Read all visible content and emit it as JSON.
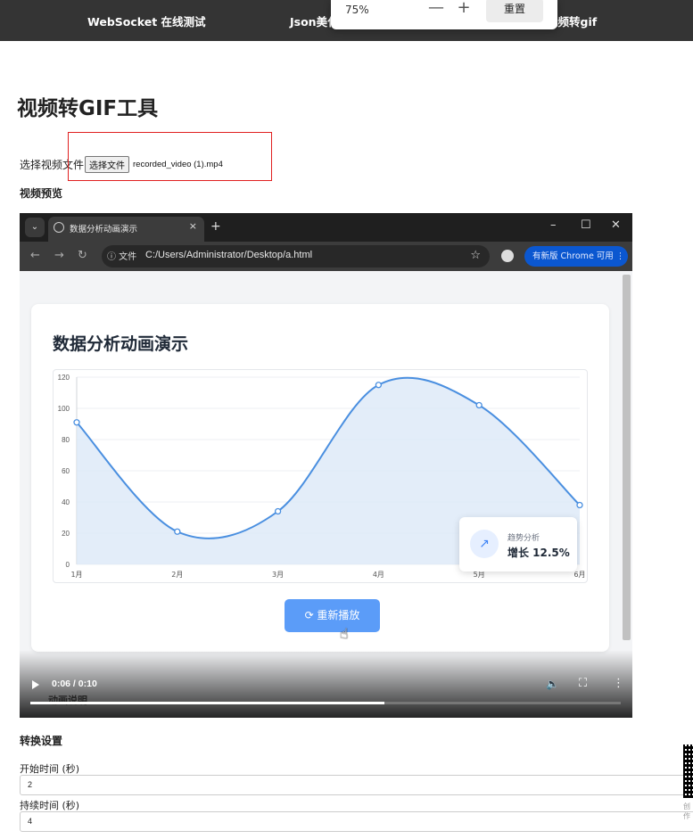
{
  "topnav": {
    "links": [
      "WebSocket 在线测试",
      "Json美化",
      "视频转gif"
    ]
  },
  "zoom": {
    "value": "75%",
    "minus": "—",
    "plus": "+",
    "reset_label": "重置"
  },
  "page": {
    "title": "视频转GIF工具",
    "file_label": "选择视频文件",
    "file_button": "选择文件",
    "file_name": "recorded_video (1).mp4",
    "preview_label": "视频预览",
    "settings_label": "转换设置"
  },
  "video": {
    "browser": {
      "tab_title": "数据分析动画演示",
      "tab_close": "×",
      "new_tab": "+",
      "info_label": "ⓘ 文件",
      "url": "C:/Users/Administrator/Desktop/a.html",
      "update_label": "有新版 Chrome 可用 ⋮",
      "win_min": "–",
      "win_max": "☐",
      "win_close": "✕"
    },
    "card_title": "数据分析动画演示",
    "trend": {
      "label": "趋势分析",
      "value": "增长 12.5%"
    },
    "replay_label": "⟳ 重新播放",
    "time": "0:06 / 0:10",
    "progress": 0.6,
    "ghost_text": "动画说明"
  },
  "chart_data": {
    "type": "line",
    "categories": [
      "1月",
      "2月",
      "3月",
      "4月",
      "5月",
      "6月"
    ],
    "values": [
      91,
      21,
      34,
      115,
      102,
      38
    ],
    "y_ticks": [
      "0",
      "20",
      "40",
      "60",
      "80",
      "100",
      "120"
    ],
    "ylim": [
      0,
      120
    ],
    "grid": true,
    "colors": {
      "line": "#4a8fe0",
      "fill": "#dce8f8"
    }
  },
  "settings": {
    "start_label": "开始时间 (秒)",
    "start_value": "2",
    "duration_label": "持续时间 (秒)",
    "duration_value": "4"
  },
  "qr_caption": "创作"
}
